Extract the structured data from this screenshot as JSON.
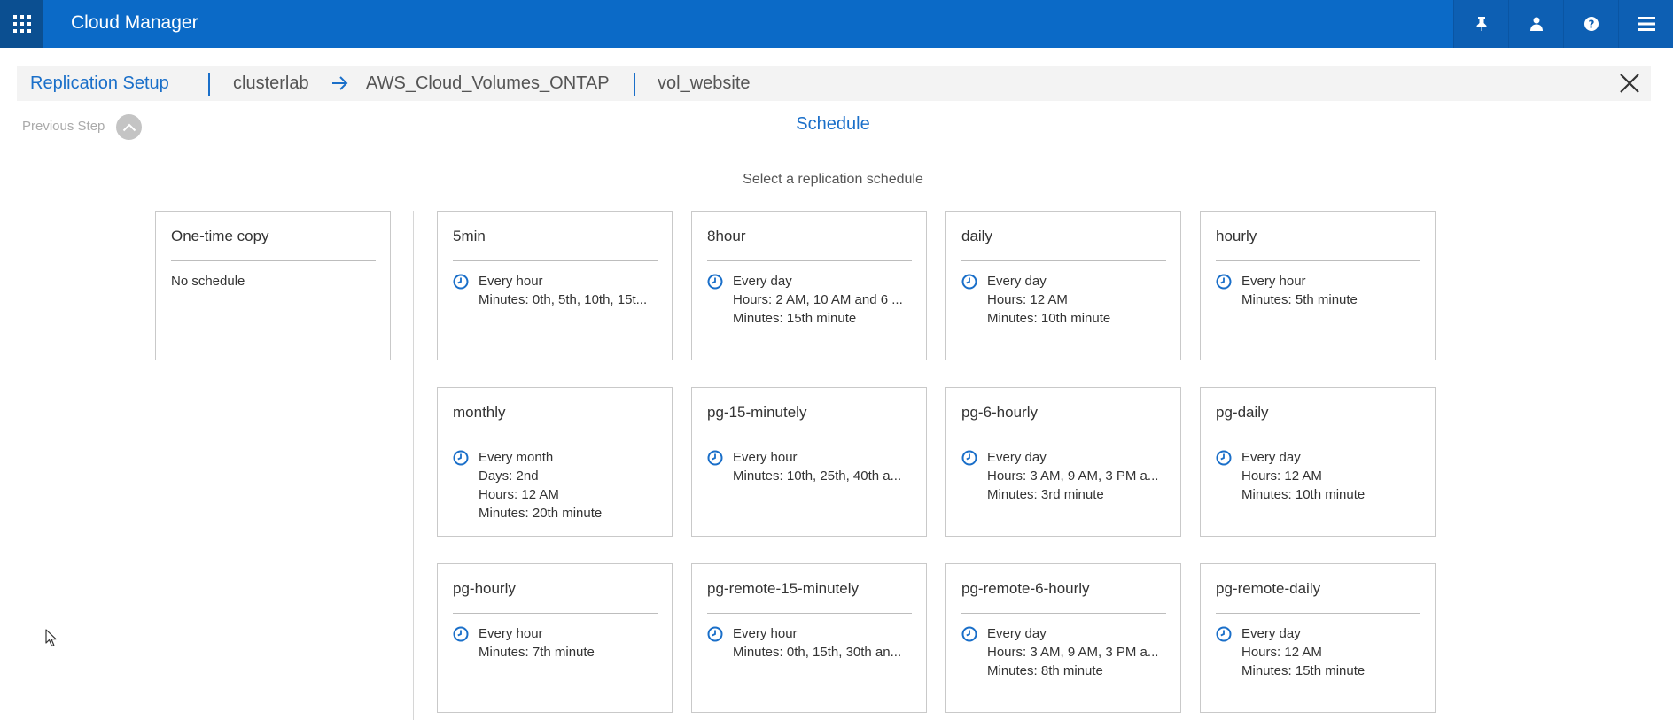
{
  "app": {
    "title": "Cloud Manager"
  },
  "topbar": {
    "icons": [
      "pin-icon",
      "user-icon",
      "help-icon",
      "menu-icon"
    ]
  },
  "breadcrumb": {
    "title": "Replication Setup",
    "source": "clusterlab",
    "destination": "AWS_Cloud_Volumes_ONTAP",
    "volume": "vol_website"
  },
  "step": {
    "previous_label": "Previous Step",
    "title": "Schedule",
    "instruction": "Select a replication schedule"
  },
  "one_time": {
    "title": "One-time copy",
    "body": "No schedule"
  },
  "schedules": [
    {
      "name": "5min",
      "lines": [
        "Every hour",
        "Minutes: 0th, 5th, 10th, 15t..."
      ]
    },
    {
      "name": "8hour",
      "lines": [
        "Every day",
        "Hours: 2 AM, 10 AM and 6 ...",
        "Minutes: 15th minute"
      ]
    },
    {
      "name": "daily",
      "lines": [
        "Every day",
        "Hours: 12 AM",
        "Minutes: 10th minute"
      ]
    },
    {
      "name": "hourly",
      "lines": [
        "Every hour",
        "Minutes: 5th minute"
      ]
    },
    {
      "name": "monthly",
      "lines": [
        "Every month",
        "Days: 2nd",
        "Hours: 12 AM",
        "Minutes: 20th minute"
      ]
    },
    {
      "name": "pg-15-minutely",
      "lines": [
        "Every hour",
        "Minutes: 10th, 25th, 40th a..."
      ]
    },
    {
      "name": "pg-6-hourly",
      "lines": [
        "Every day",
        "Hours: 3 AM, 9 AM, 3 PM a...",
        "Minutes: 3rd minute"
      ]
    },
    {
      "name": "pg-daily",
      "lines": [
        "Every day",
        "Hours: 12 AM",
        "Minutes: 10th minute"
      ]
    },
    {
      "name": "pg-hourly",
      "lines": [
        "Every hour",
        "Minutes: 7th minute"
      ]
    },
    {
      "name": "pg-remote-15-minutely",
      "lines": [
        "Every hour",
        "Minutes: 0th, 15th, 30th an..."
      ]
    },
    {
      "name": "pg-remote-6-hourly",
      "lines": [
        "Every day",
        "Hours: 3 AM, 9 AM, 3 PM a...",
        "Minutes: 8th minute"
      ]
    },
    {
      "name": "pg-remote-daily",
      "lines": [
        "Every day",
        "Hours: 12 AM",
        "Minutes: 15th minute"
      ]
    }
  ],
  "colors": {
    "brand": "#0b6ac7",
    "accent": "#1a6fc9"
  }
}
